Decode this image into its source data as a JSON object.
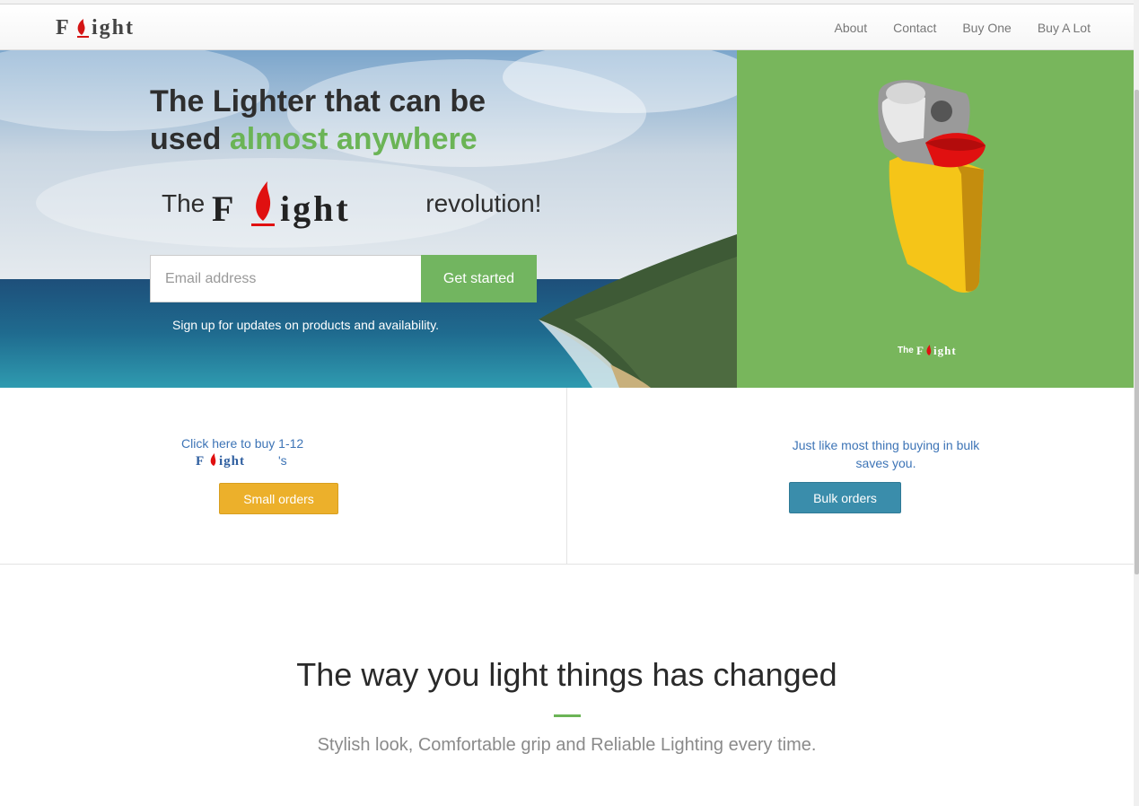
{
  "brand": {
    "logo_text": "Flight",
    "logo_prefix": "F",
    "logo_suffix": "ight"
  },
  "nav": {
    "items": [
      {
        "label": "About"
      },
      {
        "label": "Contact"
      },
      {
        "label": "Buy One"
      },
      {
        "label": "Buy A Lot"
      }
    ]
  },
  "hero": {
    "title_line1": "The Lighter that can be",
    "title_line2_prefix": "used ",
    "title_line2_accent": "almost anywhere",
    "revolution_prefix": "The",
    "revolution_suffix": "revolution!",
    "email_placeholder": "Email address",
    "cta_label": "Get started",
    "signup_note": "Sign up for updates on products and availability."
  },
  "panel": {
    "brand_prefix": "The"
  },
  "orders": {
    "small_text_line1": "Click here to buy 1-12",
    "small_text_suffix": "'s",
    "small_button": "Small orders",
    "bulk_text": "Just like most thing buying in bulk saves you.",
    "bulk_button": "Bulk orders"
  },
  "section": {
    "title": "The way you light things has changed",
    "subtitle": "Stylish look, Comfortable grip and Reliable Lighting every time."
  },
  "colors": {
    "accent_green": "#6bb456",
    "panel_green": "#78b65c",
    "small_orders": "#ecb02b",
    "bulk_orders": "#3a8dab",
    "link_blue": "#3d74b6"
  }
}
